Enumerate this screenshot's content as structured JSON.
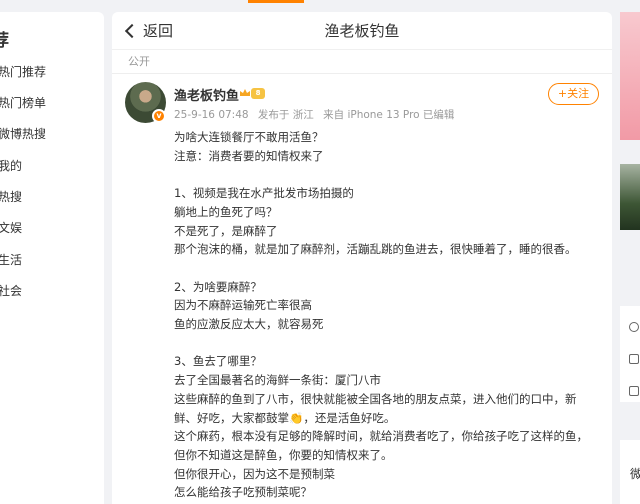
{
  "sidebar": {
    "title": "荐",
    "items": [
      {
        "label": "热门推荐"
      },
      {
        "label": "热门榜单"
      },
      {
        "label": "微博热搜"
      },
      {
        "label": "我的"
      },
      {
        "label": "热搜"
      },
      {
        "label": "文娱"
      },
      {
        "label": "生活"
      },
      {
        "label": "社会"
      }
    ]
  },
  "header": {
    "back_label": "返回",
    "title": "渔老板钓鱼"
  },
  "post": {
    "visibility": "公开",
    "author": "渔老板钓鱼",
    "vip_label": "8",
    "avatar_badge": "v",
    "date": "25-9-16 07:48",
    "location": "发布于 浙江",
    "source": "来自 iPhone 13 Pro 已编辑",
    "follow_label": "+关注",
    "lines": [
      "为啥大连锁餐厅不敢用活鱼？",
      "注意：消费者要的知情权来了",
      "",
      "1、视频是我在水产批发市场拍摄的",
      "躺地上的鱼死了吗？",
      "不是死了，是麻醉了",
      "那个泡沫的桶，就是加了麻醉剂，活蹦乱跳的鱼进去，很快睡着了，睡的很香。",
      "",
      "2、为啥要麻醉？",
      "因为不麻醉运输死亡率很高",
      "鱼的应激反应太大，就容易死",
      "",
      "3、鱼去了哪里？",
      "去了全国最著名的海鲜一条街：厦门八市",
      "这些麻醉的鱼到了八市，很快就能被全国各地的朋友点菜，进入他们的口中，新",
      "鲜、好吃，大家都鼓掌👏，还是活鱼好吃。",
      "这个麻药，根本没有足够的降解时间，就给消费者吃了，你给孩子吃了这样的鱼，",
      "但你不知道这是醉鱼，你要的知情权来了。",
      "但你很开心，因为这不是预制菜",
      "怎么能给孩子吃预制菜呢？"
    ]
  },
  "right": {
    "panel_label": "微"
  },
  "colors": {
    "accent": "#ff8200",
    "background": "#f1f2f5"
  }
}
